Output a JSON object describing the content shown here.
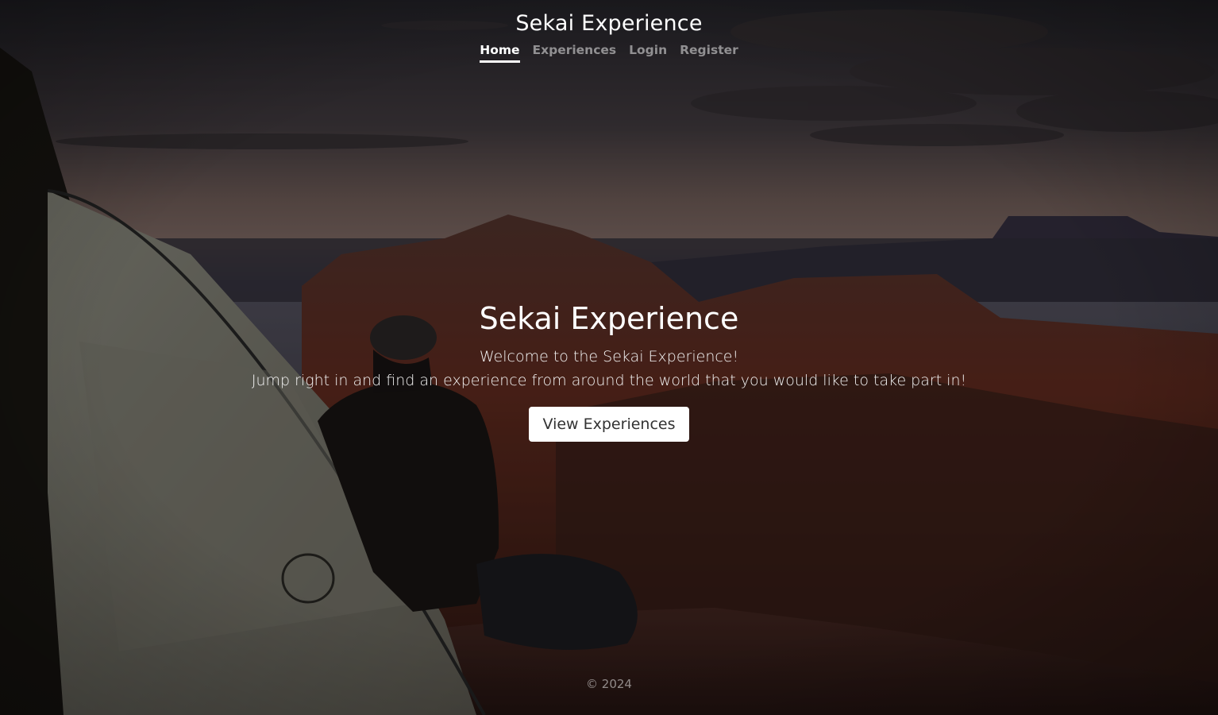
{
  "header": {
    "brand": "Sekai Experience",
    "nav": [
      {
        "label": "Home",
        "active": true
      },
      {
        "label": "Experiences",
        "active": false
      },
      {
        "label": "Login",
        "active": false
      },
      {
        "label": "Register",
        "active": false
      }
    ]
  },
  "hero": {
    "title": "Sekai Experience",
    "line1": "Welcome to the Sekai Experience!",
    "line2": "Jump right in and find an experience from around the world that you would like to take part in!",
    "button_label": "View Experiences"
  },
  "footer": {
    "copyright": "© 2024"
  },
  "colors": {
    "overlay": "#000000",
    "sky_top": "#2b2a33",
    "sky_glow": "#8a6f6a",
    "canyon": "#5a2f22",
    "button_bg": "#ffffff"
  }
}
